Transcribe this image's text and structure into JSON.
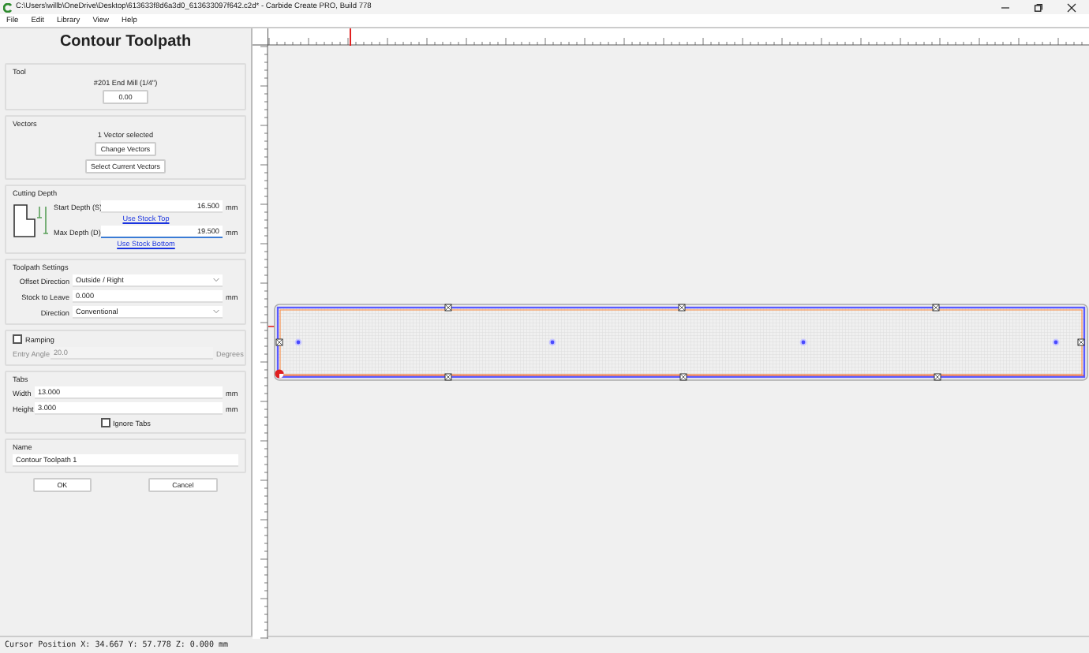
{
  "window": {
    "title": "C:\\Users\\willb\\OneDrive\\Desktop\\613633f8d6a3d0_613633097f642.c2d* - Carbide Create PRO, Build 778"
  },
  "menu": [
    "File",
    "Edit",
    "Library",
    "View",
    "Help"
  ],
  "panel": {
    "title": "Contour Toolpath",
    "tool": {
      "label": "Tool",
      "name": "#201 End Mill (1/4\")",
      "button": "0.00"
    },
    "vectors": {
      "label": "Vectors",
      "status": "1 Vector selected",
      "buttons": [
        "Change Vectors",
        "Select Current Vectors"
      ]
    },
    "cutting_depth": {
      "label": "Cutting Depth",
      "fields": [
        {
          "label": "Start Depth (S)",
          "value": "16.500",
          "unit": "mm",
          "link": "Use Stock Top"
        },
        {
          "label": "Max Depth (D)",
          "value": "19.500",
          "unit": "mm",
          "link": "Use Stock Bottom"
        }
      ]
    },
    "toolpath_settings": {
      "label": "Toolpath Settings",
      "rows": [
        {
          "kind": "dropdown",
          "label": "Offset Direction",
          "value": "Outside / Right"
        },
        {
          "kind": "input",
          "label": "Stock to Leave",
          "value": "0.000",
          "unit": "mm"
        },
        {
          "kind": "dropdown",
          "label": "Direction",
          "value": "Conventional"
        }
      ]
    },
    "ramping": {
      "label": "Ramping",
      "checked": false,
      "field": {
        "label": "Entry Angle",
        "value": "20.0",
        "unit": "Degrees"
      }
    },
    "tabs": {
      "label": "Tabs",
      "fields": [
        {
          "label": "Width",
          "value": "13.000",
          "unit": "mm"
        },
        {
          "label": "Height",
          "value": "3.000",
          "unit": "mm"
        }
      ],
      "ignore": {
        "label": "Ignore Tabs",
        "checked": false
      }
    },
    "name": {
      "label": "Name",
      "value": "Contour Toolpath 1"
    },
    "buttons": [
      "OK",
      "Cancel"
    ]
  },
  "status_bar": "Cursor Position X: 34.667 Y: 57.778 Z: 0.000 mm"
}
